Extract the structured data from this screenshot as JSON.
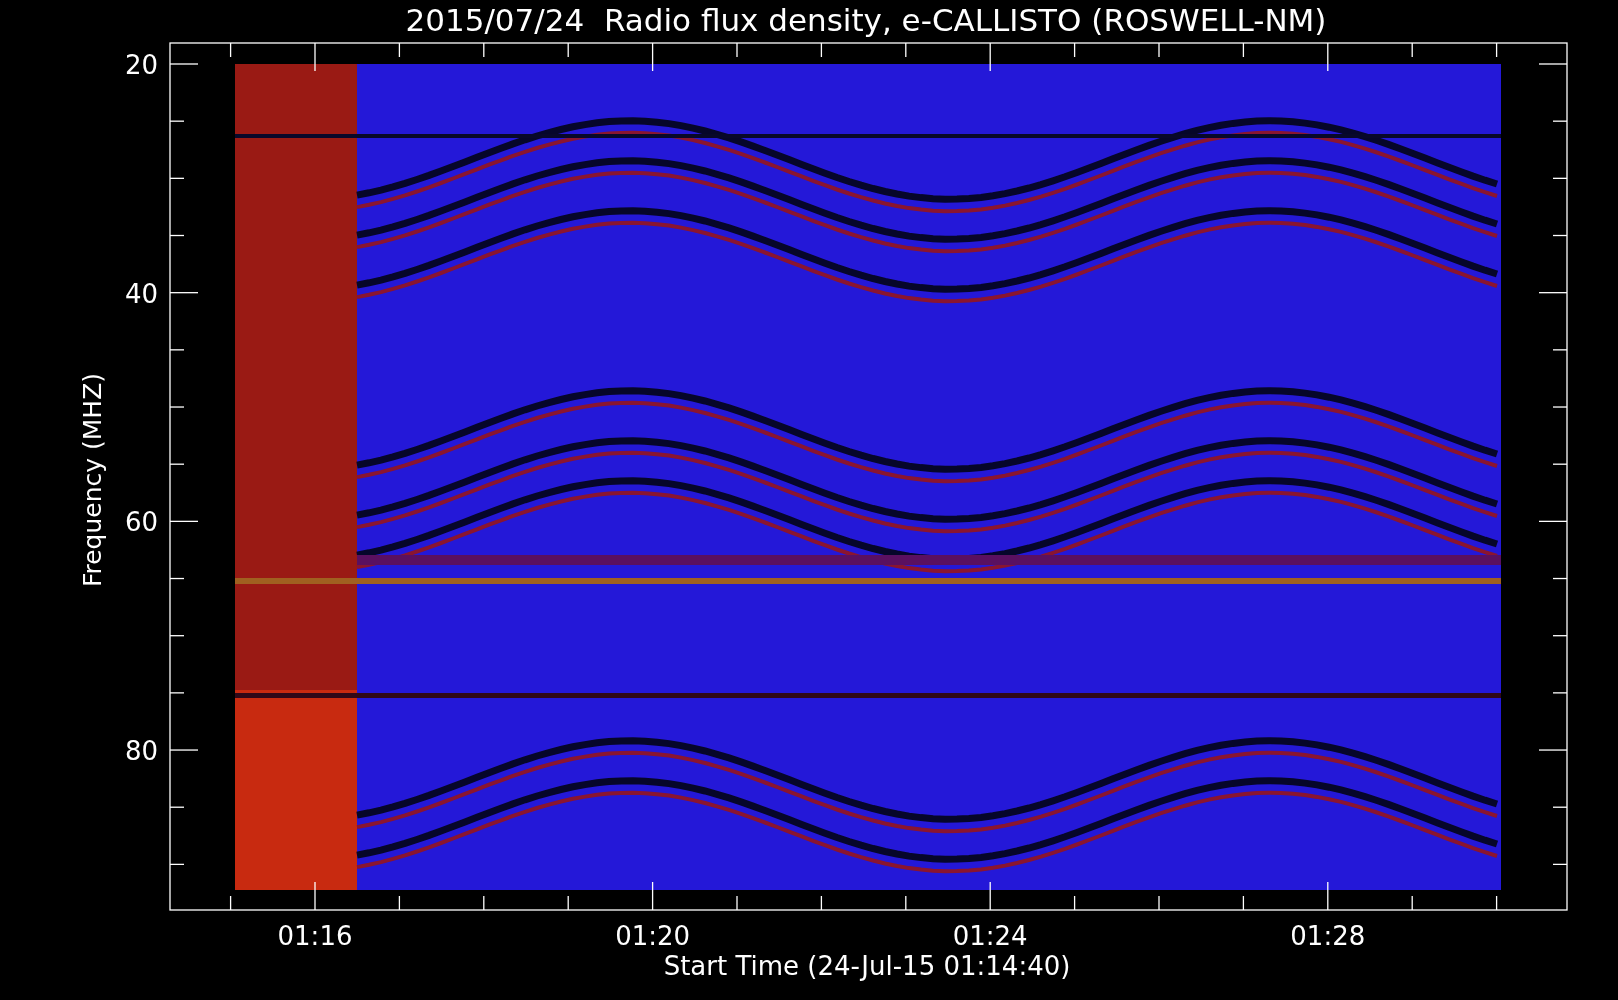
{
  "title": "2015/07/24  Radio flux density, e-CALLISTO (ROSWELL-NM)",
  "y_axis": {
    "label": "Frequency (MHZ)",
    "ticks": [
      "20",
      "40",
      "60",
      "80"
    ]
  },
  "x_axis": {
    "label": "Start Time (24-Jul-15 01:14:40)",
    "ticks": [
      "01:16",
      "01:20",
      "01:24",
      "01:28"
    ]
  }
}
